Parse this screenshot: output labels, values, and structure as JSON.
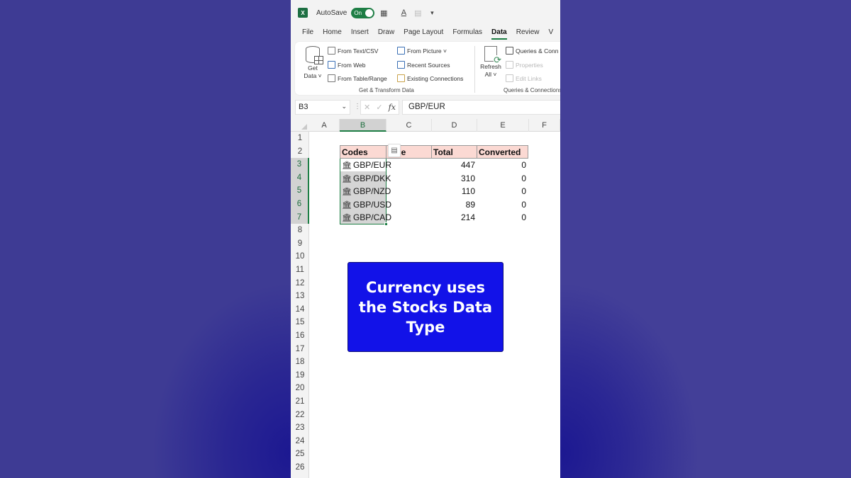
{
  "titlebar": {
    "autosave_label": "AutoSave",
    "autosave_state": "On",
    "customize_arrow": "▾"
  },
  "tabs": [
    {
      "label": "File"
    },
    {
      "label": "Home"
    },
    {
      "label": "Insert"
    },
    {
      "label": "Draw"
    },
    {
      "label": "Page Layout"
    },
    {
      "label": "Formulas"
    },
    {
      "label": "Data",
      "active": true
    },
    {
      "label": "Review"
    },
    {
      "label": "V"
    }
  ],
  "ribbon": {
    "get_data": {
      "line1": "Get",
      "line2": "Data ˅"
    },
    "get_transform": {
      "from_text_csv": "From Text/CSV",
      "from_web": "From Web",
      "from_table_range": "From Table/Range",
      "from_picture": "From Picture ˅",
      "recent_sources": "Recent Sources",
      "existing_connections": "Existing Connections",
      "group_label": "Get & Transform Data"
    },
    "refresh_all": {
      "line1": "Refresh",
      "line2": "All ˅"
    },
    "queries": {
      "queries_connections": "Queries & Conn",
      "properties": "Properties",
      "edit_links": "Edit Links",
      "group_label": "Queries & Connections"
    }
  },
  "formula_bar": {
    "name_box": "B3",
    "cancel_icon": "✕",
    "enter_icon": "✓",
    "fx_label": "fx",
    "formula": "GBP/EUR"
  },
  "columns": [
    "A",
    "B",
    "C",
    "D",
    "E",
    "F"
  ],
  "selected_column": "B",
  "rows": [
    "1",
    "2",
    "3",
    "4",
    "5",
    "6",
    "7",
    "8",
    "9",
    "10",
    "11",
    "12",
    "13",
    "14",
    "15",
    "16",
    "17",
    "18",
    "19",
    "20",
    "21",
    "22",
    "23",
    "24",
    "25",
    "26"
  ],
  "table": {
    "headers": {
      "codes": "Codes",
      "price": "ce",
      "total": "Total",
      "converted": "Converted"
    },
    "data": [
      {
        "code": "GBP/EUR",
        "total": "447",
        "converted": "0"
      },
      {
        "code": "GBP/DKK",
        "total": "310",
        "converted": "0"
      },
      {
        "code": "GBP/NZD",
        "total": "110",
        "converted": "0"
      },
      {
        "code": "GBP/USD",
        "total": "89",
        "converted": "0"
      },
      {
        "code": "GBP/CAD",
        "total": "214",
        "converted": "0"
      }
    ]
  },
  "callout": {
    "text": "Currency uses the Stocks Data Type",
    "color": "#1212e8"
  },
  "colors": {
    "excel_green": "#1e7e45",
    "header_fill": "#fbd9d3",
    "background": "#3f3c95"
  }
}
